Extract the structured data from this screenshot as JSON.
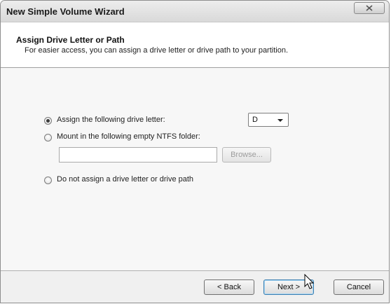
{
  "window": {
    "title": "New Simple Volume Wizard",
    "close_icon": "close-icon"
  },
  "header": {
    "title": "Assign Drive Letter or Path",
    "subtitle": "For easier access, you can assign a drive letter or drive path to your partition."
  },
  "options": {
    "assign_letter": {
      "label": "Assign the following drive letter:",
      "checked": true
    },
    "mount_folder": {
      "label": "Mount in the following empty NTFS folder:",
      "checked": false
    },
    "no_assign": {
      "label": "Do not assign a drive letter or drive path",
      "checked": false
    }
  },
  "drive_letter": {
    "selected": "D"
  },
  "folder_path": {
    "value": ""
  },
  "browse_button": {
    "label": "Browse...",
    "enabled": false
  },
  "footer": {
    "back_label": "< Back",
    "next_label": "Next >",
    "cancel_label": "Cancel"
  }
}
